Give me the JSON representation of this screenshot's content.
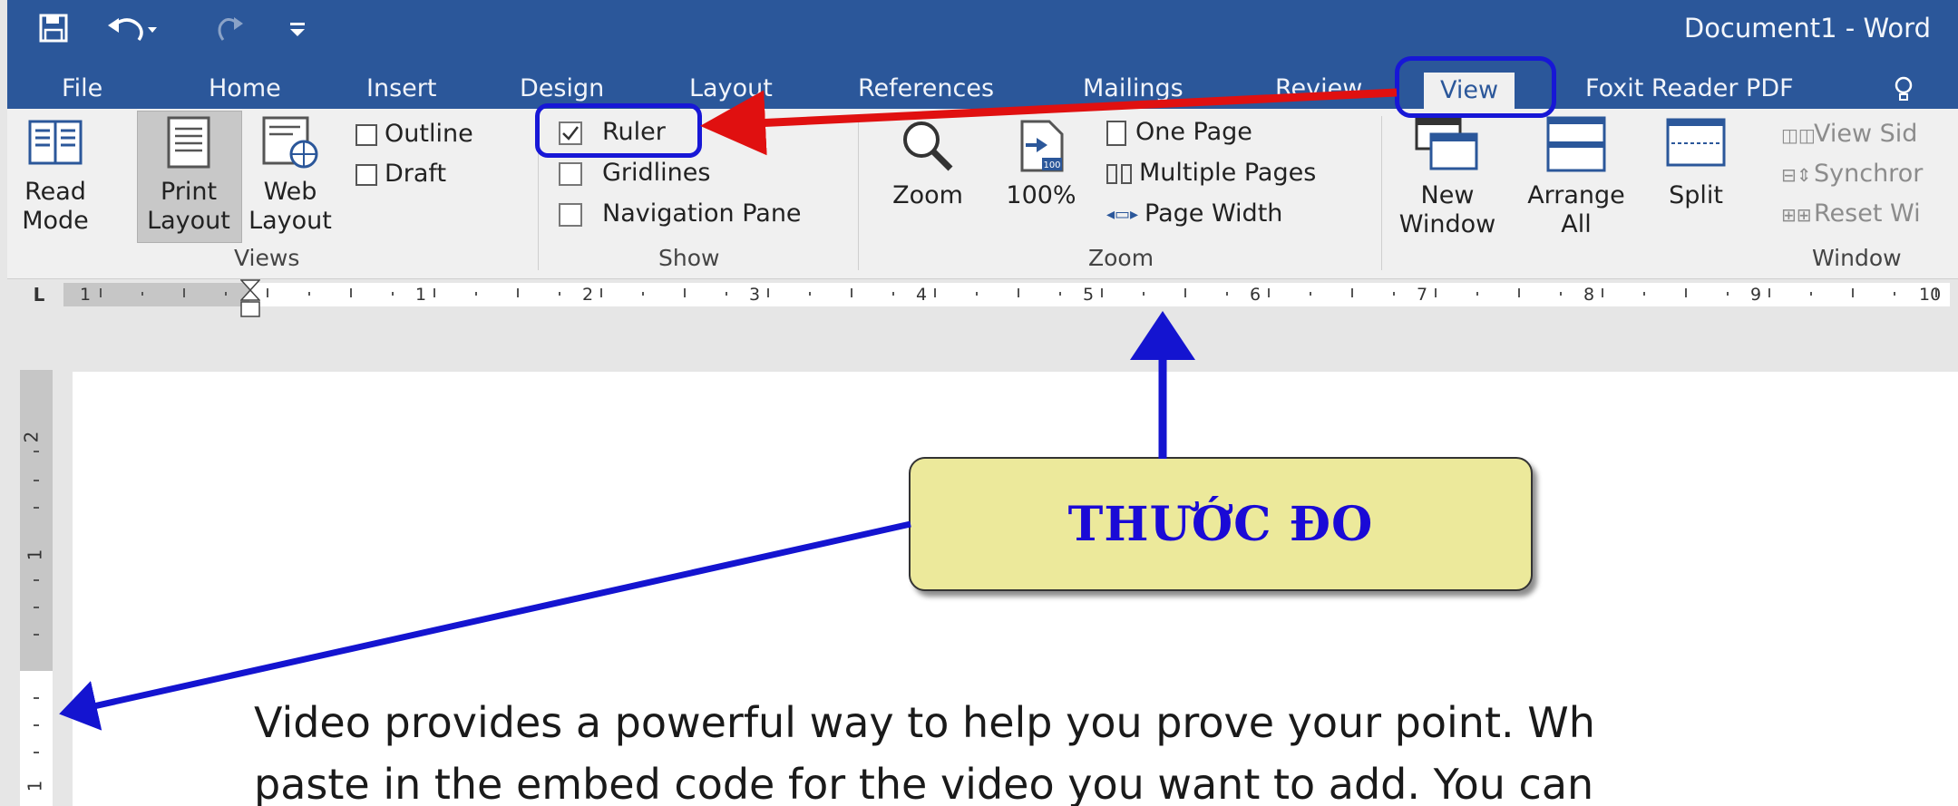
{
  "window": {
    "title": "Document1 - Word"
  },
  "tabs": [
    {
      "label": "File"
    },
    {
      "label": "Home"
    },
    {
      "label": "Insert"
    },
    {
      "label": "Design"
    },
    {
      "label": "Layout"
    },
    {
      "label": "References"
    },
    {
      "label": "Mailings"
    },
    {
      "label": "Review"
    },
    {
      "label": "View",
      "active": true
    },
    {
      "label": "Foxit Reader PDF"
    }
  ],
  "ribbon": {
    "views": {
      "label": "Views",
      "read_mode": [
        "Read",
        "Mode"
      ],
      "print_layout": [
        "Print",
        "Layout"
      ],
      "web_layout": [
        "Web",
        "Layout"
      ],
      "outline": "Outline",
      "draft": "Draft"
    },
    "show": {
      "label": "Show",
      "ruler": "Ruler",
      "ruler_checked": true,
      "gridlines": "Gridlines",
      "gridlines_checked": false,
      "navigation_pane": "Navigation Pane",
      "navigation_pane_checked": false
    },
    "zoom": {
      "label": "Zoom",
      "zoom": "Zoom",
      "hundred": "100%",
      "one_page": "One Page",
      "multiple_pages": "Multiple Pages",
      "page_width": "Page Width"
    },
    "window": {
      "label": "Window",
      "new_window": [
        "New",
        "Window"
      ],
      "arrange_all": [
        "Arrange",
        "All"
      ],
      "split": "Split",
      "view_side": "View Sid",
      "synchronous": "Synchror",
      "reset_window": "Reset Wi"
    }
  },
  "ruler": {
    "tab_selector": "L",
    "ticks": [
      "1",
      "1",
      "2",
      "3",
      "4",
      "5",
      "6",
      "7",
      "8",
      "9",
      "10"
    ],
    "vertical_ticks": [
      "2",
      "1",
      "1"
    ]
  },
  "callout": {
    "text": "THƯỚC ĐO"
  },
  "document": {
    "lines": [
      "Video provides a powerful way to help you prove your point. Wh",
      "paste in the embed code for the video you want to add. You can"
    ]
  },
  "colors": {
    "title_bar": "#2b579a",
    "ribbon": "#f0f0f0",
    "callout_fill": "#ece99b",
    "callout_text": "#1a0ad6",
    "arrow_red": "#e01010",
    "arrow_blue": "#1414d0"
  }
}
